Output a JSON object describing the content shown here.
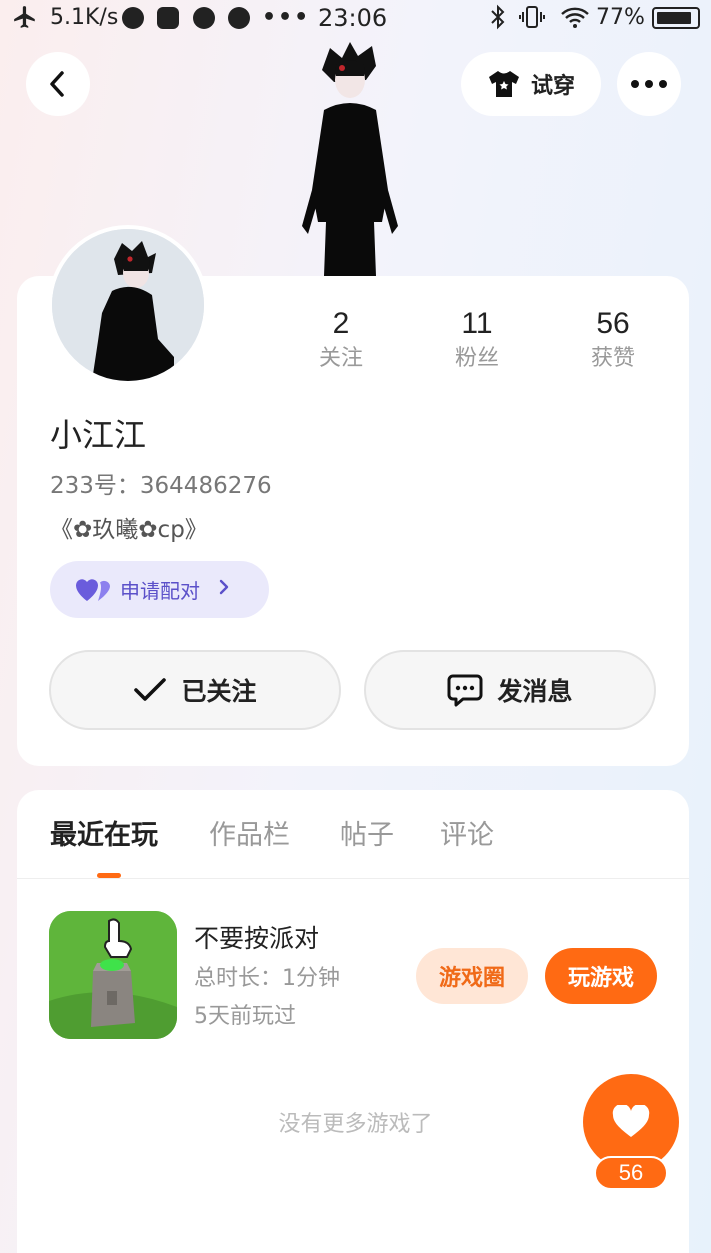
{
  "status_bar": {
    "speed": "5.1K/s",
    "time": "23:06",
    "battery": "77%"
  },
  "header": {
    "try_on_label": "试穿"
  },
  "stats": [
    {
      "value": "2",
      "label": "关注"
    },
    {
      "value": "11",
      "label": "粉丝"
    },
    {
      "value": "56",
      "label": "获赞"
    }
  ],
  "profile": {
    "username": "小江江",
    "id_label": "233号：",
    "id_value": "364486276",
    "bio": "《✿玖曦✿cp》",
    "pair_label": "申请配对",
    "follow_label": "已关注",
    "message_label": "发消息"
  },
  "tabs": [
    "最近在玩",
    "作品栏",
    "帖子",
    "评论"
  ],
  "game": {
    "title": "不要按派对",
    "duration": "总时长：1分钟",
    "last_played": "5天前玩过",
    "circle_label": "游戏圈",
    "play_label": "玩游戏"
  },
  "list_end": "没有更多游戏了",
  "likes": {
    "count": "56"
  },
  "colors": {
    "accent": "#ff6a13",
    "pair_bg": "#eae9fb",
    "pair_text": "#5b50c9"
  }
}
